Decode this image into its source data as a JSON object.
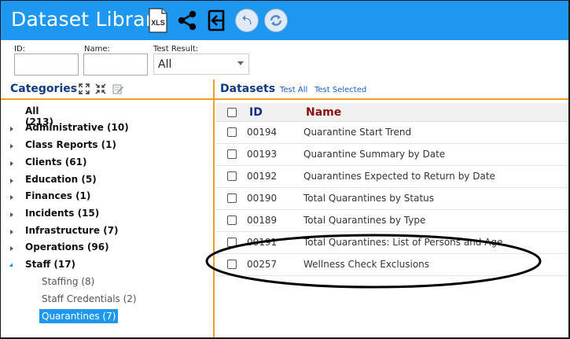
{
  "app": {
    "title": "Dataset Library"
  },
  "toolbar": {
    "xls_label": "XLS"
  },
  "filters": {
    "id_label": "ID:",
    "name_label": "Name:",
    "result_label": "Test Result:",
    "result_value": "All"
  },
  "categories": {
    "title": "Categories",
    "items": [
      {
        "label": "All (213)"
      },
      {
        "label": "Administrative (10)"
      },
      {
        "label": "Class Reports (1)"
      },
      {
        "label": "Clients (61)"
      },
      {
        "label": "Education (5)"
      },
      {
        "label": "Finances (1)"
      },
      {
        "label": "Incidents (15)"
      },
      {
        "label": "Infrastructure (7)"
      },
      {
        "label": "Operations (96)"
      },
      {
        "label": "Staff (17)"
      }
    ],
    "staff_children": [
      {
        "label": "Staffing (8)"
      },
      {
        "label": "Staff Credentials (2)"
      },
      {
        "label": "Quarantines (7)"
      }
    ]
  },
  "datasets": {
    "title": "Datasets",
    "test_all": "Test All",
    "test_selected": "Test Selected",
    "col_id": "ID",
    "col_name": "Name",
    "rows": [
      {
        "id": "00194",
        "name": "Quarantine Start Trend"
      },
      {
        "id": "00193",
        "name": "Quarantine Summary by Date"
      },
      {
        "id": "00192",
        "name": "Quarantines Expected to Return by Date"
      },
      {
        "id": "00190",
        "name": "Total Quarantines by Status"
      },
      {
        "id": "00189",
        "name": "Total Quarantines by Type"
      },
      {
        "id": "00191",
        "name": "Total Quarantines: List of Persons and Age"
      },
      {
        "id": "00257",
        "name": "Wellness Check Exclusions"
      }
    ]
  },
  "colors": {
    "header": "#1e97f0",
    "accent_divider": "#f0a028",
    "selected": "#1e97f0",
    "title_navy": "#123a82",
    "name_header": "#8a1010"
  }
}
